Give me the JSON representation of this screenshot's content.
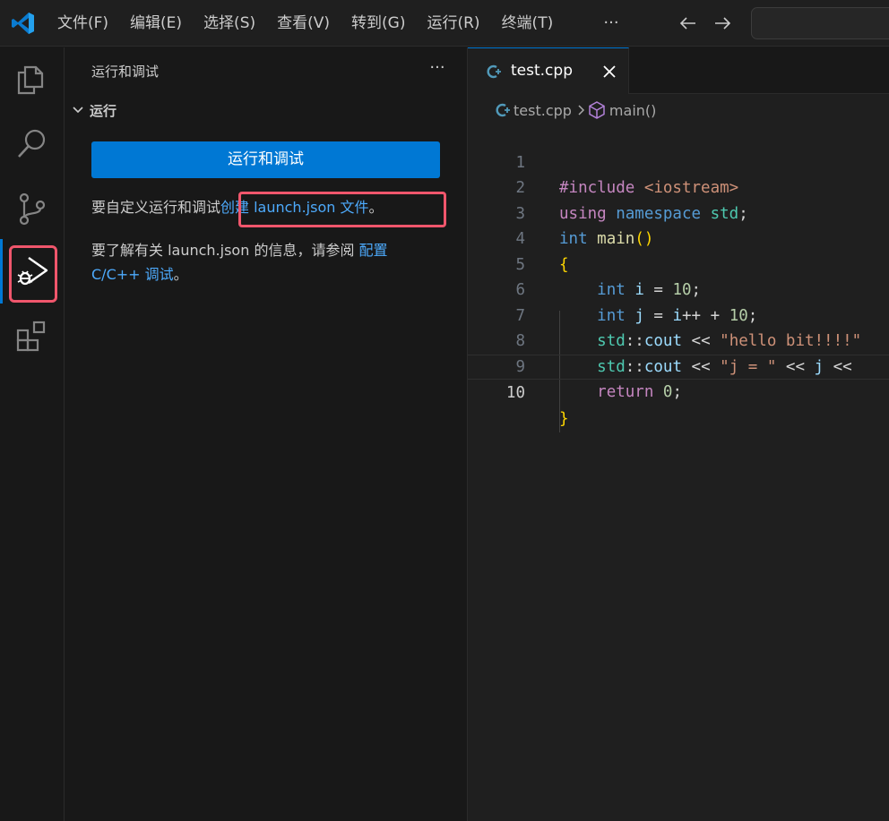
{
  "menu": {
    "items": [
      "文件(F)",
      "编辑(E)",
      "选择(S)",
      "查看(V)",
      "转到(G)",
      "运行(R)",
      "终端(T)"
    ],
    "more": "···"
  },
  "colors": {
    "accent": "#0078d4",
    "link": "#4daafc",
    "highlight": "#f0566c"
  },
  "activity_bar": {
    "items": [
      "explorer-icon",
      "search-icon",
      "source-control-icon",
      "run-debug-icon",
      "extensions-icon"
    ],
    "active": "run-debug-icon"
  },
  "sidebar": {
    "title": "运行和调试",
    "more": "···",
    "section": "运行",
    "run_button": "运行和调试",
    "para1_prefix": "要自定义运行和调试",
    "para1_link": "创建 launch.json 文件",
    "para1_suffix": "。",
    "para2_prefix": "要了解有关 launch.json 的信息，请参阅 ",
    "para2_link_a": "配置",
    "para2_link_b": "C/C++ 调试",
    "para2_suffix": "。"
  },
  "editor": {
    "tab_label": "test.cpp",
    "breadcrumb_file": "test.cpp",
    "breadcrumb_symbol": "main()",
    "current_line": 10,
    "line_numbers": [
      "1",
      "2",
      "3",
      "4",
      "5",
      "6",
      "7",
      "8",
      "9",
      "10"
    ],
    "code": {
      "l1": [
        "#include ",
        "<iostream>"
      ],
      "l2": [
        "using ",
        "namespace ",
        "std",
        ";"
      ],
      "l3": [
        "int ",
        "main",
        "()"
      ],
      "l4": [
        "{"
      ],
      "l5": [
        "    ",
        "int ",
        "i",
        " = ",
        "10",
        ";"
      ],
      "l6": [
        "    ",
        "int ",
        "j",
        " = ",
        "i",
        "++ + ",
        "10",
        ";"
      ],
      "l7": [
        "    ",
        "std",
        "::",
        "cout",
        " << ",
        "\"hello bit!!!!\""
      ],
      "l8": [
        "    ",
        "std",
        "::",
        "cout",
        " << ",
        "\"j = \"",
        " << ",
        "j",
        " <<"
      ],
      "l9": [
        "    ",
        "return ",
        "0",
        ";"
      ],
      "l10": [
        "}"
      ]
    }
  }
}
